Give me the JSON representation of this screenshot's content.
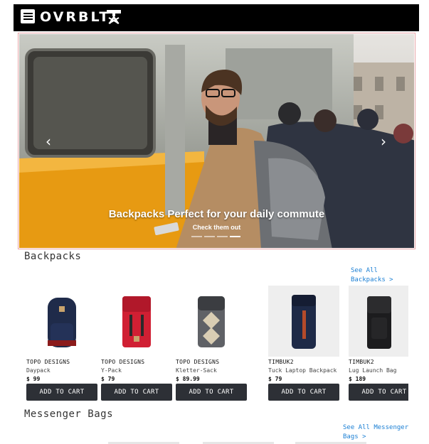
{
  "header": {
    "logo_text": "OVRBLT",
    "menu_icon": "hamburger-icon",
    "logo_mark_icon": "tools-logo-icon"
  },
  "carousel": {
    "heading": "Backpacks Perfect for your daily commute",
    "subtext": "Check them out",
    "prev_icon": "chevron-left-icon",
    "next_icon": "chevron-right-icon",
    "prev_glyph": "‹",
    "next_glyph": "›",
    "slide_count": 4,
    "active_slide": 4
  },
  "sections": {
    "backpacks": {
      "title": "Backpacks",
      "see_all_line1": "See All",
      "see_all_line2": "Backpacks >",
      "products": [
        {
          "brand": "TOPO DESIGNS",
          "name": "Daypack",
          "price": "$ 99",
          "cta": "ADD TO CART"
        },
        {
          "brand": "TOPO DESIGNS",
          "name": "Y-Pack",
          "price": "$ 79",
          "cta": "ADD TO CART"
        },
        {
          "brand": "TOPO DESIGNS",
          "name": "Kletter-Sack",
          "price": "$ 89.99",
          "cta": "ADD TO CART"
        },
        {
          "brand": "TIMBUK2",
          "name": "Tuck Laptop Backpack",
          "price": "$ 79",
          "cta": "ADD TO CART"
        },
        {
          "brand": "TIMBUK2",
          "name": "Lug Launch Bag",
          "price": "$ 189",
          "cta": "ADD TO CART"
        }
      ]
    },
    "messenger": {
      "title": "Messenger Bags",
      "see_all_line1": "See All Messenger",
      "see_all_line2": "Bags >"
    }
  },
  "colors": {
    "navbar": "#000000",
    "button": "#2d3036",
    "link": "#1a7fd4",
    "carousel_border": "#e8a5a8"
  }
}
